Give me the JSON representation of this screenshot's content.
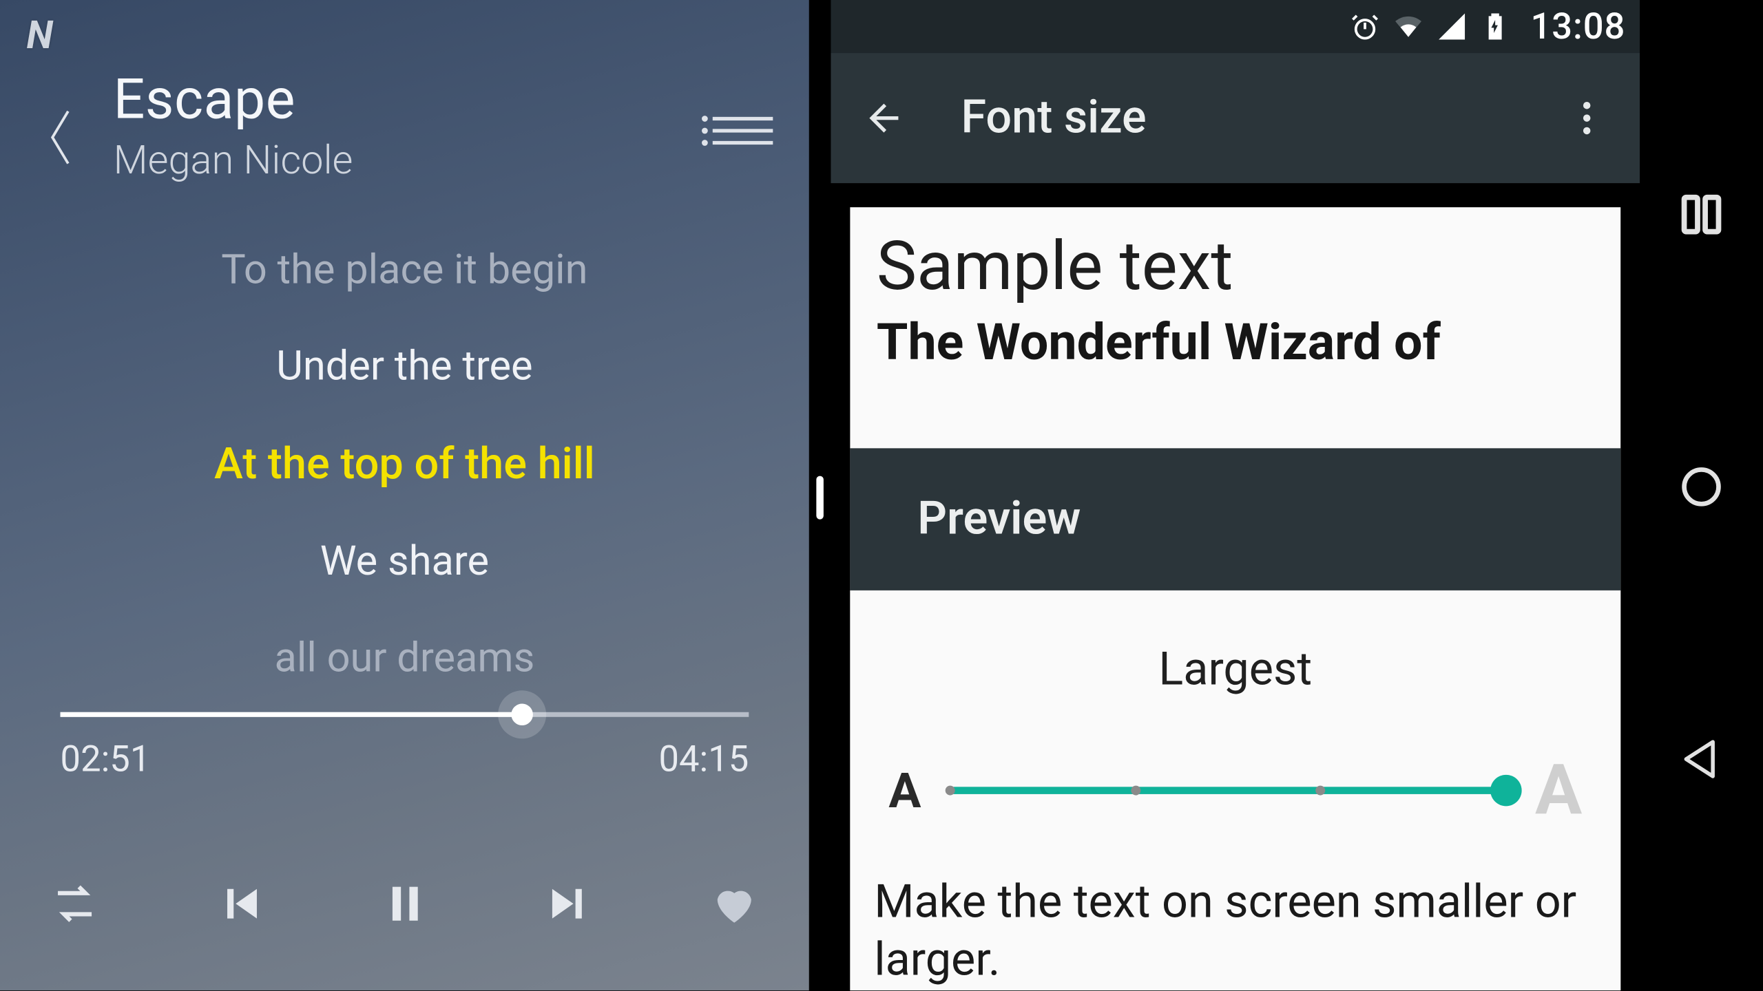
{
  "music": {
    "badge": "N",
    "title": "Escape",
    "artist": "Megan Nicole",
    "lyrics": {
      "lines": [
        {
          "text": "To the place it begin",
          "state": "faded"
        },
        {
          "text": "Under the tree",
          "state": "normal"
        },
        {
          "text": "At the top of the hill",
          "state": "active"
        },
        {
          "text": "We share",
          "state": "normal"
        },
        {
          "text": "all our dreams",
          "state": "faded"
        }
      ]
    },
    "progress": {
      "elapsed": "02:51",
      "total": "04:15",
      "percent": 67
    }
  },
  "statusbar": {
    "time": "13:08"
  },
  "settings": {
    "appbar_title": "Font size",
    "sample_heading": "Sample text",
    "sample_subtitle": "The Wonderful Wizard of",
    "preview_label": "Preview",
    "size_label": "Largest",
    "slider": {
      "steps": 4,
      "value_index": 3
    },
    "A_small": "A",
    "A_large": "A",
    "description": "Make the text on screen smaller or larger."
  }
}
